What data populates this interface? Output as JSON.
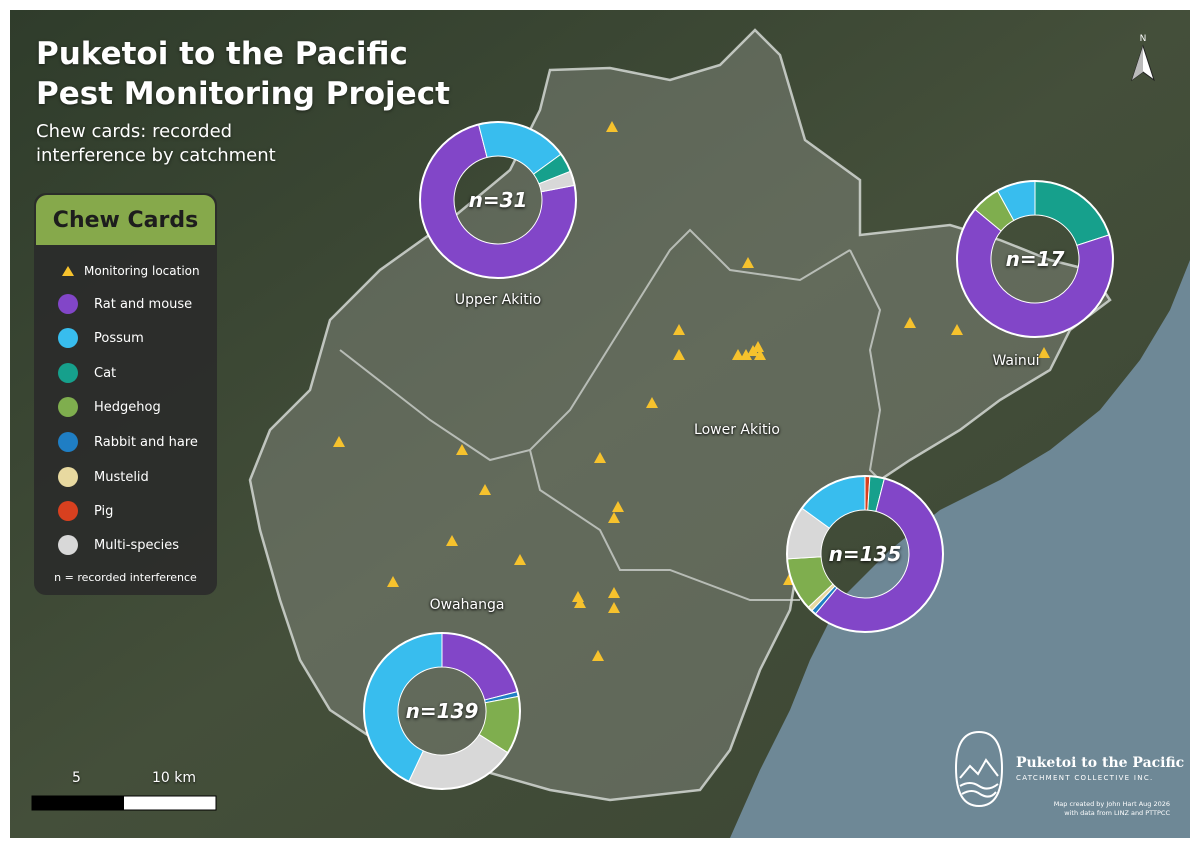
{
  "title_line1": "Puketoi to the Pacific",
  "title_line2": "Pest Monitoring Project",
  "subtitle_line1": "Chew cards: recorded",
  "subtitle_line2": "interference by catchment",
  "legend": {
    "heading": "Chew Cards",
    "monitoring_label": "Monitoring location",
    "monitoring_color": "#f6c22d",
    "items": [
      {
        "label": "Rat and mouse",
        "color": "#8246c8"
      },
      {
        "label": "Possum",
        "color": "#38bdee"
      },
      {
        "label": "Cat",
        "color": "#16a08c"
      },
      {
        "label": "Hedgehog",
        "color": "#7fae4e"
      },
      {
        "label": "Rabbit and hare",
        "color": "#1f7ec4"
      },
      {
        "label": "Mustelid",
        "color": "#e8d9a0"
      },
      {
        "label": "Pig",
        "color": "#d8401f"
      },
      {
        "label": "Multi-species",
        "color": "#d8d8d8"
      }
    ],
    "note": "n = recorded interference"
  },
  "catchments": [
    {
      "name": "Upper Akitio",
      "n_label": "n=31",
      "n": 31,
      "shares": {
        "Rat and mouse": 0.74,
        "Possum": 0.19,
        "Cat": 0.04,
        "Multi-species": 0.03
      }
    },
    {
      "name": "Wainui",
      "n_label": "n=17",
      "n": 17,
      "shares": {
        "Cat": 0.2,
        "Rat and mouse": 0.66,
        "Hedgehog": 0.06,
        "Possum": 0.08
      }
    },
    {
      "name": "Lower Akitio",
      "n_label": "n=135",
      "n": 135,
      "shares": {
        "Pig": 0.01,
        "Cat": 0.03,
        "Rat and mouse": 0.57,
        "Rabbit and hare": 0.01,
        "Mustelid": 0.01,
        "Hedgehog": 0.11,
        "Multi-species": 0.11,
        "Possum": 0.15
      }
    },
    {
      "name": "Owahanga",
      "n_label": "n=139",
      "n": 139,
      "shares": {
        "Rat and mouse": 0.21,
        "Rabbit and hare": 0.01,
        "Hedgehog": 0.12,
        "Multi-species": 0.23,
        "Possum": 0.43
      }
    }
  ],
  "scale": {
    "label_5": "5",
    "label_10": "10 km"
  },
  "north": "N",
  "logo": {
    "name": "Puketoi to the Pacific",
    "sub": "CATCHMENT COLLECTIVE INC."
  },
  "credit_line1": "Map created by John Hart Aug 2026",
  "credit_line2": "with data from LINZ and PTTPCC",
  "colors": {
    "background": "#3a4632",
    "sea": "#6e8896",
    "study_area": "#8a8e84",
    "boundary": "#d4d8d4"
  }
}
